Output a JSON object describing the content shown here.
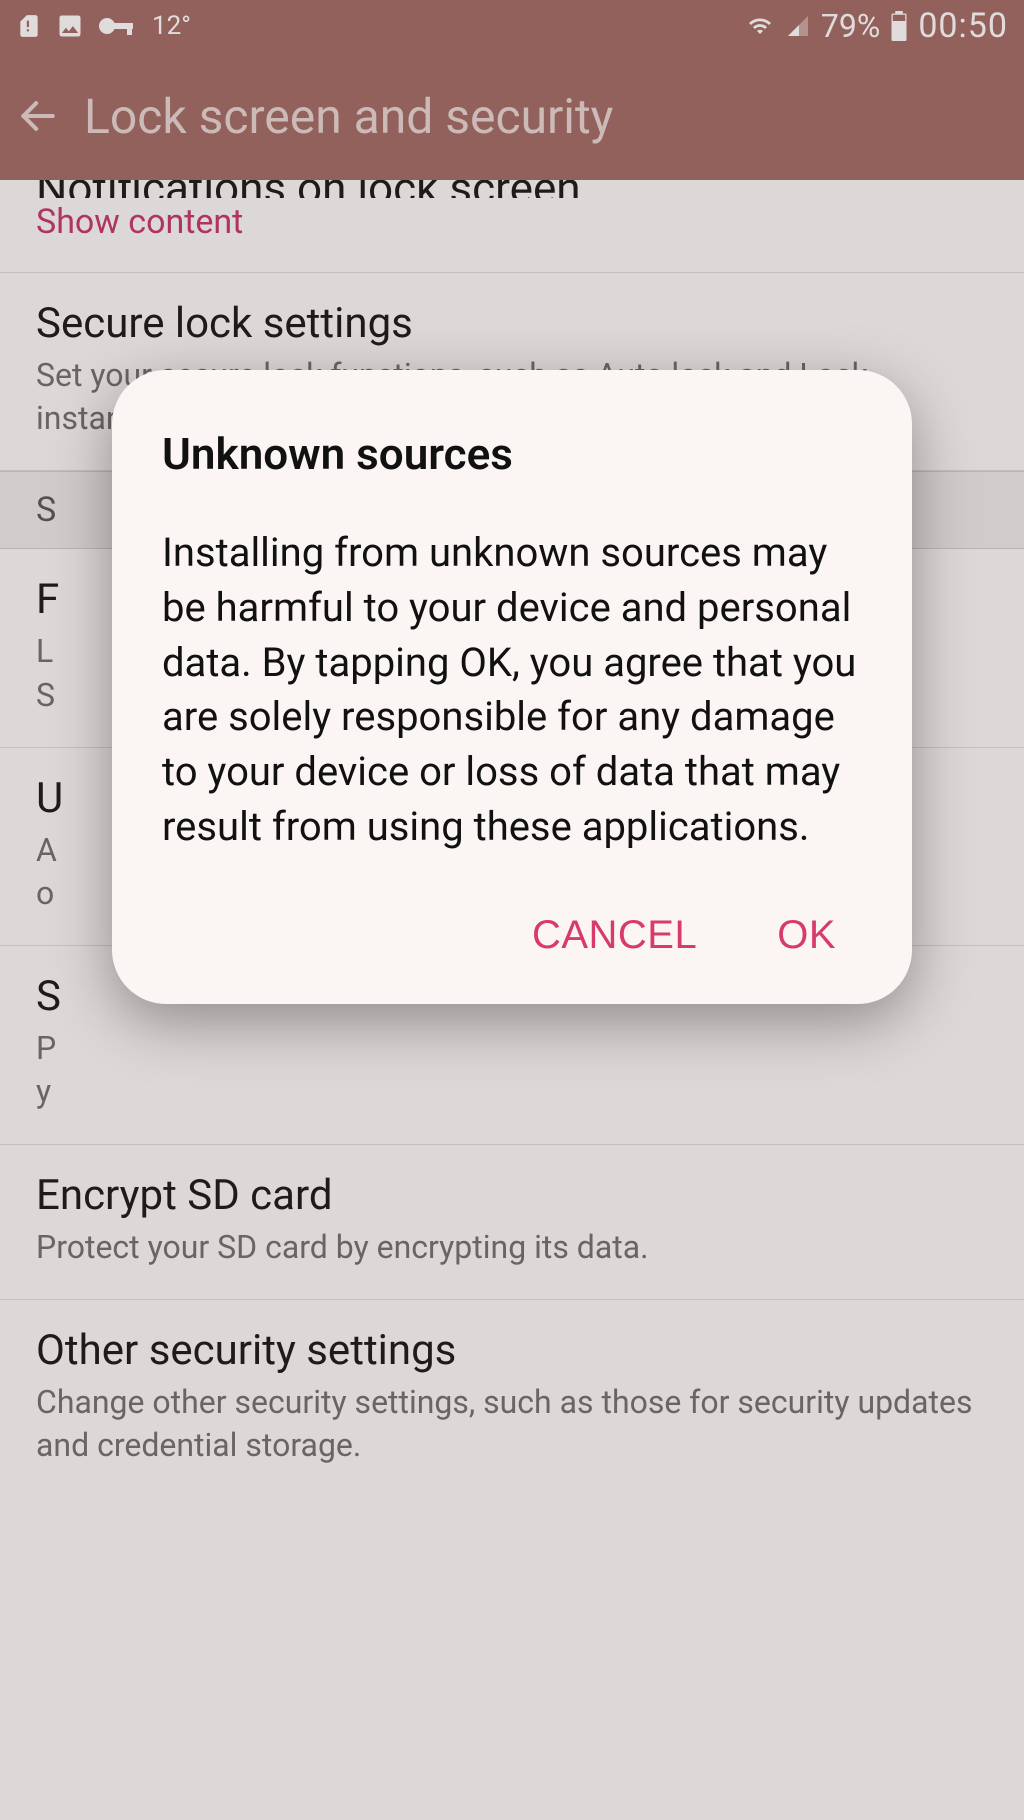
{
  "status": {
    "temperature": "12°",
    "battery_pct": "79%",
    "time": "00:50"
  },
  "appbar": {
    "title": "Lock screen and security"
  },
  "list": {
    "notifications": {
      "title_cut": "Notifications on lock screen",
      "accent": "Show content"
    },
    "secure_lock": {
      "title": "Secure lock settings",
      "subtitle": "Set your secure lock functions, such as Auto lock and Lock instantly with Power key."
    },
    "section_security_letter": "S",
    "find_mobile_letter": "F",
    "find_mobile_sub_l1": "L",
    "find_mobile_sub_l2": "S",
    "unknown_letter": "U",
    "unknown_sub_l1": "A",
    "unknown_sub_l2": "o",
    "secure_startup_letter": "S",
    "secure_startup_sub_l1": "P",
    "secure_startup_sub_l2": "y",
    "encrypt_sd": {
      "title": "Encrypt SD card",
      "subtitle": "Protect your SD card by encrypting its data."
    },
    "other": {
      "title": "Other security settings",
      "subtitle": "Change other security settings, such as those for security updates and credential storage."
    }
  },
  "dialog": {
    "title": "Unknown sources",
    "body": "Installing from unknown sources may be harmful to your device and personal data. By tapping OK, you agree that you are solely responsible for any damage to your device or loss of data that may result from using these applications.",
    "cancel": "CANCEL",
    "ok": "OK"
  }
}
